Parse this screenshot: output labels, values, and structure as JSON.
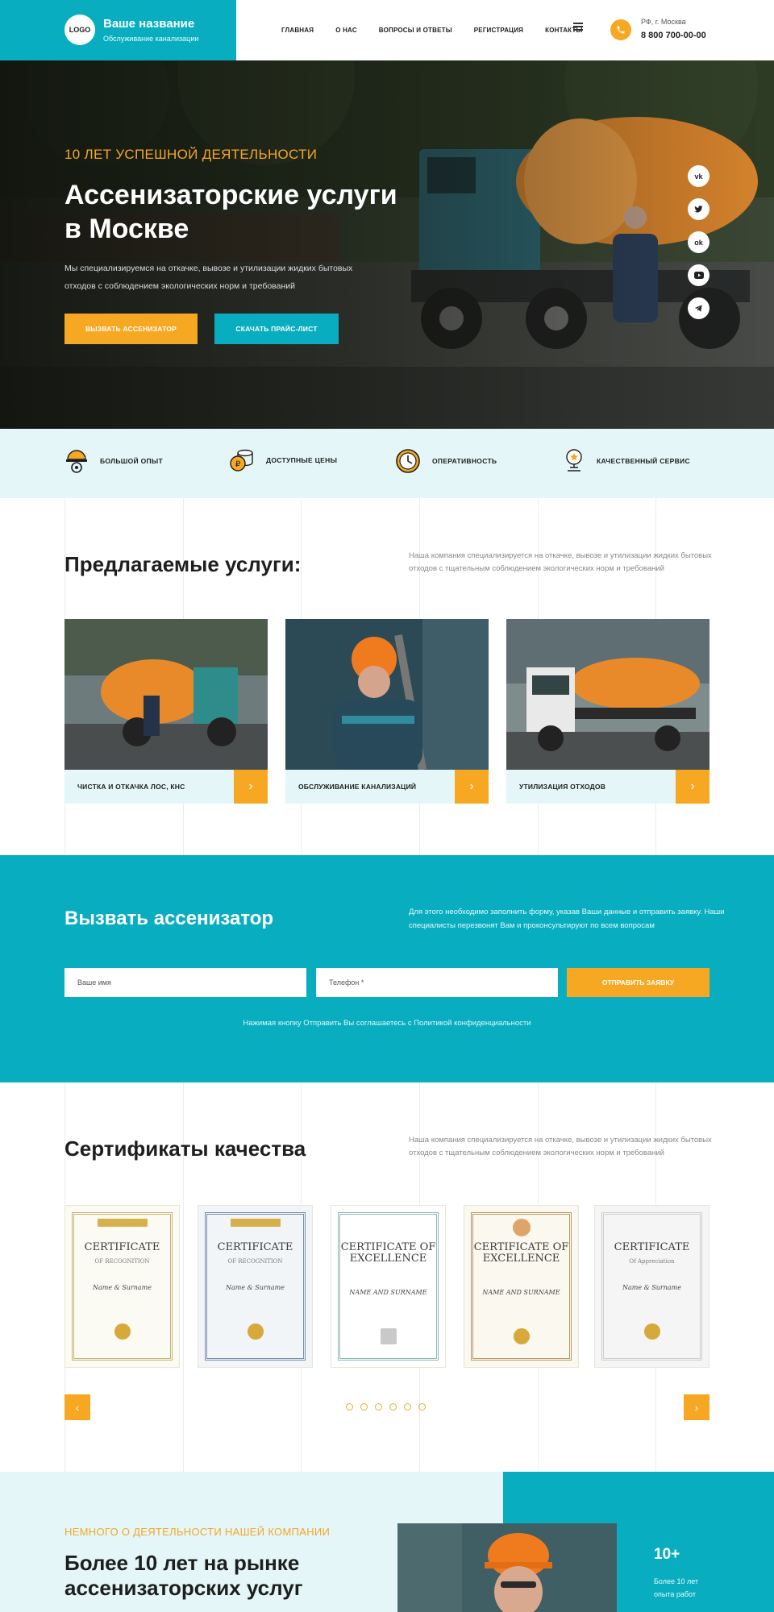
{
  "header": {
    "logo": "LOGO",
    "title": "Ваше название",
    "subtitle": "Обслуживание канализации",
    "nav": [
      "ГЛАВНАЯ",
      "О НАС",
      "ВОПРОСЫ И ОТВЕТЫ",
      "РЕГИСТРАЦИЯ",
      "КОНТАКТЫ"
    ],
    "city": "РФ, г. Москва",
    "phone": "8 800 700-00-00"
  },
  "hero": {
    "kicker": "10 ЛЕТ УСПЕШНОЙ ДЕЯТЕЛЬНОСТИ",
    "title": "Ассенизаторские услуги в Москве",
    "text": "Мы специализируемся на откачке, вывозе и утилизации жидких бытовых отходов с соблюдением экологических норм и требований",
    "btn_primary": "ВЫЗВАТЬ АССЕНИЗАТОР",
    "btn_secondary": "СКАЧАТЬ ПРАЙС-ЛИСТ",
    "socials": [
      "vk-icon",
      "twitter-icon",
      "odnoklassniki-icon",
      "youtube-icon",
      "telegram-icon"
    ]
  },
  "features": [
    "БОЛЬШОЙ ОПЫТ",
    "ДОСТУПНЫЕ ЦЕНЫ",
    "ОПЕРАТИВНОСТЬ",
    "КАЧЕСТВЕННЫЙ СЕРВИС"
  ],
  "services": {
    "title": "Предлагаемые услуги:",
    "text": "Наша компания специализируется на откачке, вывозе и утилизации жидких бытовых отходов с тщательным соблюдением экологических норм и требований",
    "items": [
      "ЧИСТКА И ОТКАЧКА ЛОС, КНС",
      "ОБСЛУЖИВАНИЕ КАНАЛИЗАЦИЙ",
      "УТИЛИЗАЦИЯ ОТХОДОВ"
    ]
  },
  "callback": {
    "title": "Вызвать ассенизатор",
    "text": "Для этого необходимо заполнить форму, указав Ваши данные и отправить заявку. Наши специалисты перезвонят Вам и проконсультируют по всем вопросам",
    "name_placeholder": "Ваше имя",
    "phone_placeholder": "Телефон *",
    "submit": "ОТПРАВИТЬ ЗАЯВКУ",
    "note": "Нажимая кнопку Отправить Вы соглашаетесь с Политикой конфиденциальности"
  },
  "certificates": {
    "title": "Сертификаты качества",
    "text": "Наша компания специализируется на откачке, вывозе и утилизации жидких бытовых отходов с тщательным соблюдением экологических норм и требований",
    "items": [
      {
        "title": "CERTIFICATE",
        "sub": "OF RECOGNITION",
        "name": "Name & Surname"
      },
      {
        "title": "CERTIFICATE",
        "sub": "OF RECOGNITION",
        "name": "Name & Surname"
      },
      {
        "title": "CERTIFICATE OF EXCELLENCE",
        "sub": "",
        "name": "NAME AND SURNAME"
      },
      {
        "title": "CERTIFICATE OF EXCELLENCE",
        "sub": "",
        "name": "NAME AND SURNAME"
      },
      {
        "title": "CERTIFICATE",
        "sub": "Of Appreciation",
        "name": "Name & Surname"
      }
    ],
    "prev": "‹",
    "next": "›"
  },
  "about": {
    "kicker": "НЕМНОГО О ДЕЯТЕЛЬНОСТИ НАШЕЙ КОМПАНИИ",
    "title": "Более 10 лет на рынке ассенизаторских услуг",
    "stat_value": "10+",
    "stat_caption": "Более 10 лет опыта работ"
  },
  "colors": {
    "teal": "#08aec0",
    "orange": "#f7a823",
    "light": "#e4f6f8"
  }
}
